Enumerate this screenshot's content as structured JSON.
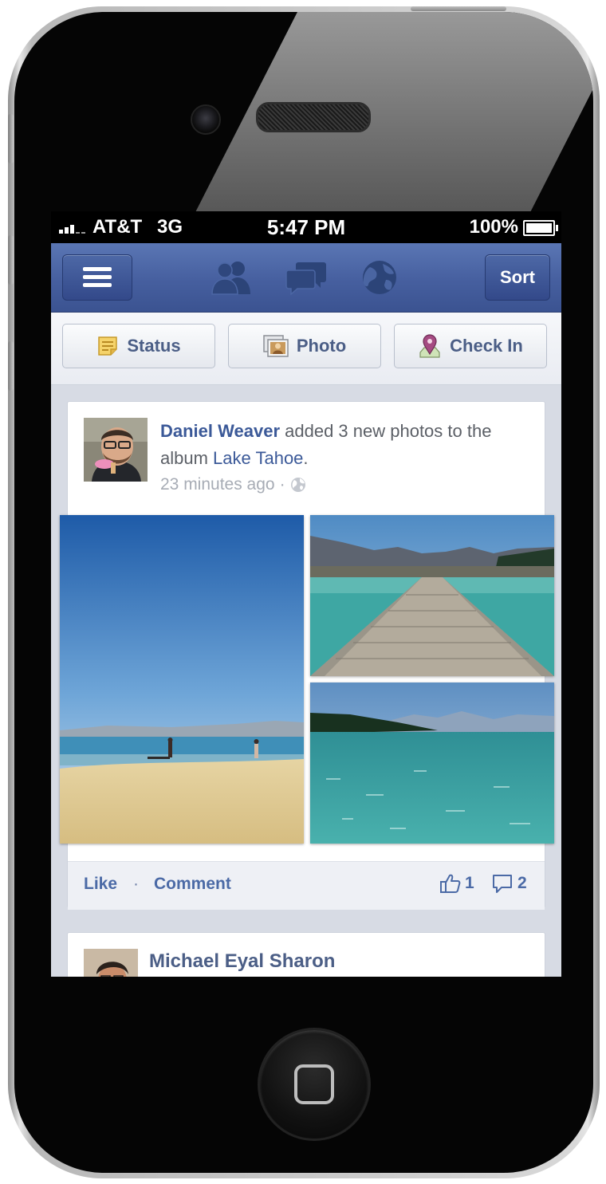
{
  "status_bar": {
    "carrier": "AT&T",
    "network": "3G",
    "time": "5:47 PM",
    "battery_percent": "100%"
  },
  "nav": {
    "menu_icon": "hamburger-icon",
    "icons": [
      "friends-icon",
      "messages-icon",
      "notifications-globe-icon"
    ],
    "sort_label": "Sort"
  },
  "publisher": {
    "status_label": "Status",
    "photo_label": "Photo",
    "checkin_label": "Check In"
  },
  "story1": {
    "actor": "Daniel Weaver",
    "action": " added 3 new photos to the album ",
    "album": "Lake Tahoe",
    "end": ".",
    "time": "23 minutes ago",
    "separator": "·",
    "privacy_icon": "globe-icon",
    "like_label": "Like",
    "ufi_separator": "·",
    "comment_label": "Comment",
    "like_count": "1",
    "comment_count": "2"
  },
  "story2": {
    "actor": "Michael Eyal Sharon"
  },
  "colors": {
    "facebook_blue": "#3b5998",
    "navbar": "#465f9f",
    "feed_background": "#d7dbe4"
  }
}
